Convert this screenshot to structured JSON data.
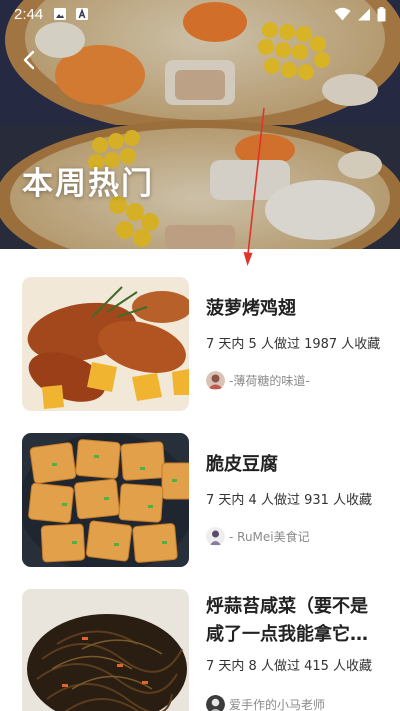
{
  "status_bar": {
    "time": "2:44",
    "icons": [
      "image-notification-icon",
      "a-notification-icon",
      "wifi-icon",
      "signal-icon",
      "battery-icon"
    ]
  },
  "header": {
    "title": "本周热门",
    "back_icon": "back-arrow-icon"
  },
  "recipes": [
    {
      "title": "菠萝烤鸡翅",
      "stats": "7 天内 5 人做过 1987 人收藏",
      "author": "-薄荷糖的味道-"
    },
    {
      "title": "脆皮豆腐",
      "stats": "7 天内 4 人做过 931 人收藏",
      "author": "- RuMei美食记"
    },
    {
      "title": "烀蒜苔咸菜（要不是咸了一点我能拿它当零食）",
      "stats": "7 天内 8 人做过 415 人收藏",
      "author": "爱手作的小马老师"
    }
  ],
  "colors": {
    "annotation_arrow": "#e0342b",
    "title_text": "#222222",
    "meta_text": "#8a8a8a"
  }
}
